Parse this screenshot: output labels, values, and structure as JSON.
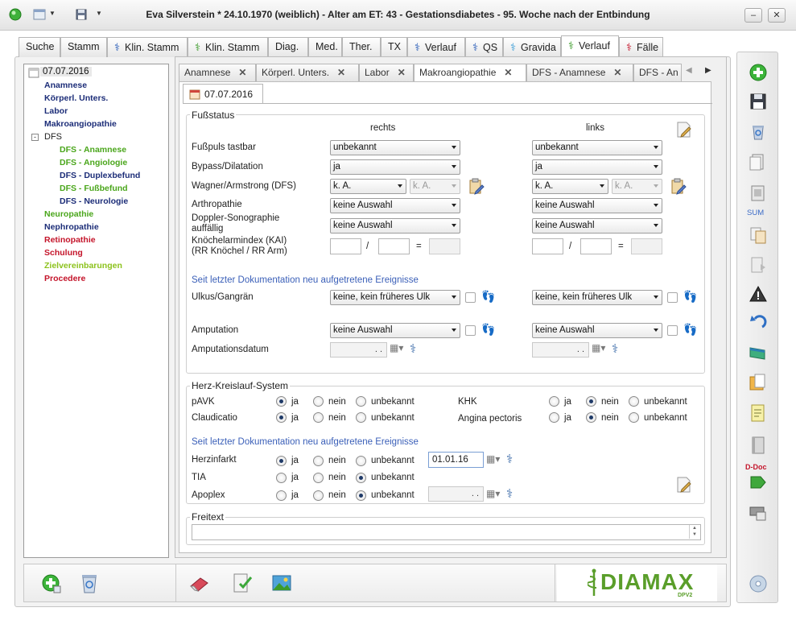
{
  "window": {
    "title": "Eva Silverstein  * 24.10.1970 (weiblich) - Alter am ET: 43 - Gestationsdiabetes - 95. Woche nach der Entbindung",
    "minimize": "–",
    "close": "✕"
  },
  "main_tabs": [
    {
      "label": "Suche",
      "icon": ""
    },
    {
      "label": "Stamm",
      "icon": ""
    },
    {
      "label": "Klin. Stamm",
      "icon": "⚕",
      "color": "#2a5db8"
    },
    {
      "label": "Klin. Stamm",
      "icon": "⚕",
      "color": "#3c9b2a"
    },
    {
      "label": "Diag.",
      "icon": ""
    },
    {
      "label": "Med.",
      "icon": ""
    },
    {
      "label": "Ther.",
      "icon": ""
    },
    {
      "label": "TX",
      "icon": ""
    },
    {
      "label": "Verlauf",
      "icon": "⚕",
      "color": "#2a5db8"
    },
    {
      "label": "QS",
      "icon": "⚕",
      "color": "#2a5db8"
    },
    {
      "label": "Gravida",
      "icon": "⚕",
      "color": "#3f9fd8"
    },
    {
      "label": "Verlauf",
      "icon": "⚕",
      "color": "#3c9b2a"
    },
    {
      "label": "Fälle",
      "icon": "⚕",
      "color": "#c4142a"
    }
  ],
  "tree": {
    "root": "07.07.2016",
    "items": [
      {
        "label": "Anamnese",
        "color": "navy"
      },
      {
        "label": "Körperl. Unters.",
        "color": "navy"
      },
      {
        "label": "Labor",
        "color": "navy"
      },
      {
        "label": "Makroangiopathie",
        "color": "navy"
      },
      {
        "label": "DFS",
        "color": "plain"
      },
      {
        "label": "DFS - Anamnese",
        "color": "green"
      },
      {
        "label": "DFS - Angiologie",
        "color": "green"
      },
      {
        "label": "DFS - Duplexbefund",
        "color": "navy"
      },
      {
        "label": "DFS - Fußbefund",
        "color": "green"
      },
      {
        "label": "DFS - Neurologie",
        "color": "navy"
      },
      {
        "label": "Neuropathie",
        "color": "green"
      },
      {
        "label": "Nephropathie",
        "color": "navy"
      },
      {
        "label": "Retinopathie",
        "color": "red"
      },
      {
        "label": "Schulung",
        "color": "red"
      },
      {
        "label": "Zielvereinbarungen",
        "color": "lime"
      },
      {
        "label": "Procedere",
        "color": "red"
      }
    ]
  },
  "sub_tabs": [
    {
      "label": "Anamnese"
    },
    {
      "label": "Körperl. Unters."
    },
    {
      "label": "Labor"
    },
    {
      "label": "Makroangiopathie"
    },
    {
      "label": "DFS - Anamnese"
    },
    {
      "label": "DFS - An"
    }
  ],
  "date_tab": "07.07.2016",
  "fuss": {
    "title": "Fußstatus",
    "col_right": "rechts",
    "col_left": "links",
    "fusspuls_label": "Fußpuls tastbar",
    "fusspuls_r": "unbekannt",
    "fusspuls_l": "unbekannt",
    "bypass_label": "Bypass/Dilatation",
    "bypass_r": "ja",
    "bypass_l": "ja",
    "wagner_label": "Wagner/Armstrong (DFS)",
    "wagner_r1": "k. A.",
    "wagner_r2": "k. A.",
    "wagner_l1": "k. A.",
    "wagner_l2": "k. A.",
    "arthro_label": "Arthropathie",
    "arthro_r": "keine Auswahl",
    "arthro_l": "keine Auswahl",
    "doppler_label1": "Doppler-Sonographie",
    "doppler_label2": "auffällig",
    "doppler_r": "keine Auswahl",
    "doppler_l": "keine Auswahl",
    "kai_label1": "Knöchelarmindex (KAI)",
    "kai_label2": "(RR Knöchel / RR Arm)",
    "slash": "/",
    "equals": "=",
    "events_heading": "Seit letzter Dokumentation neu aufgetretene Ereignisse",
    "ulkus_label": "Ulkus/Gangrän",
    "ulkus_r": "keine, kein früheres Ulk",
    "ulkus_l": "keine, kein früheres Ulk",
    "amputation_label": "Amputation",
    "amputation_r": "keine Auswahl",
    "amputation_l": "keine Auswahl",
    "amputationsdatum_label": "Amputationsdatum",
    "date_placeholder": ". ."
  },
  "herz": {
    "title": "Herz-Kreislauf-System",
    "opt_ja": "ja",
    "opt_nein": "nein",
    "opt_unbekannt": "unbekannt",
    "pavk_label": "pAVK",
    "claudicatio_label": "Claudicatio",
    "khk_label": "KHK",
    "angina_label": "Angina pectoris",
    "events_heading": "Seit letzter Dokumentation neu aufgetretene Ereignisse",
    "herzinfarkt_label": "Herzinfarkt",
    "herzinfarkt_date": "01.01.16",
    "tia_label": "TIA",
    "apoplex_label": "Apoplex",
    "apoplex_date": ". ."
  },
  "freitext": {
    "title": "Freitext",
    "value": ""
  },
  "right_toolbar": {
    "sum_label": "SUM",
    "ddoc_label": "D-Doc"
  },
  "logo": {
    "text": "DIAMAX",
    "sub": "DPV2"
  },
  "colors": {
    "accent_blue": "#3a5fb8",
    "navy": "#1c2d78",
    "green": "#4aa61b",
    "red": "#c4142a",
    "lime": "#8cc21c",
    "logo_green": "#5a9e2a"
  }
}
